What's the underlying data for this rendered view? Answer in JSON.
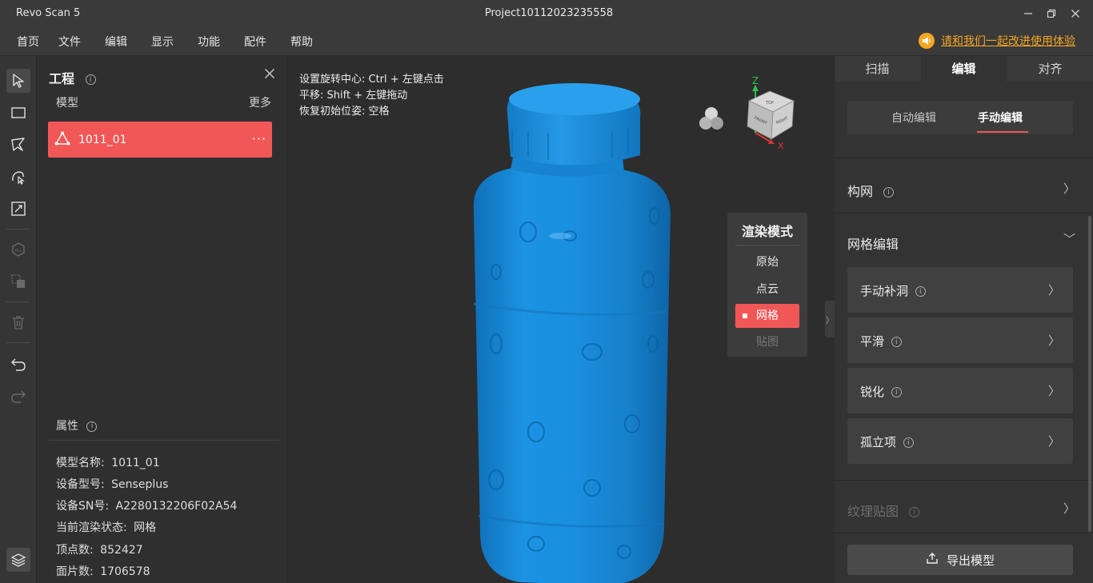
{
  "titlebar": {
    "app_name": "Revo Scan 5",
    "project_name": "Project10112023235558",
    "min_icon": "minimize-icon",
    "restore_icon": "restore-icon",
    "close_icon": "close-icon"
  },
  "menu": {
    "items": [
      "首页",
      "文件",
      "编辑",
      "显示",
      "功能",
      "配件",
      "帮助"
    ],
    "feedback_text": "请和我们一起改进使用体验"
  },
  "toolbar": {
    "tools": [
      "select-arrow-icon",
      "rect-select-icon",
      "lasso-select-icon",
      "brush-select-icon",
      "invert-select-icon",
      "select-all-icon",
      "isolate-select-icon",
      "delete-icon",
      "undo-icon",
      "redo-icon",
      "layers-icon"
    ]
  },
  "project_panel": {
    "title": "工程",
    "model_header": "模型",
    "more_label": "更多",
    "model_item": "1011_01",
    "model_item_dots": "···",
    "properties_title": "属性",
    "properties": [
      {
        "label": "模型名称:",
        "value": "1011_01"
      },
      {
        "label": "设备型号:",
        "value": "Senseplus"
      },
      {
        "label": "设备SN号:",
        "value": "A2280132206F02A54"
      },
      {
        "label": "当前渲染状态:",
        "value": "网格"
      },
      {
        "label": "顶点数:",
        "value": "852427"
      },
      {
        "label": "面片数:",
        "value": "1706578"
      }
    ]
  },
  "viewport": {
    "hints": [
      "设置旋转中心: Ctrl + 左键点击",
      "平移: Shift + 左键拖动",
      "恢复初始位姿: 空格"
    ],
    "model_color": "#1a8fe0",
    "render_mode": {
      "title": "渲染模式",
      "options": [
        "原始",
        "点云",
        "网格",
        "贴图"
      ],
      "selected": "网格",
      "disabled": "贴图"
    },
    "view_cube": {
      "axis_z": "Z",
      "axis_x": "X",
      "face_front": "FRONT",
      "face_right": "RIGHT",
      "face_top": "TOP"
    }
  },
  "right_panel": {
    "tabs": [
      "扫描",
      "编辑",
      "对齐"
    ],
    "active_tab": "编辑",
    "subtabs": [
      "自动编辑",
      "手动编辑"
    ],
    "active_subtab": "手动编辑",
    "section_mesh": "构网",
    "section_mesh_edit": "网格编辑",
    "tools": [
      "手动补洞",
      "平滑",
      "锐化",
      "孤立项"
    ],
    "section_texture": "纹理贴图",
    "export_label": "导出模型"
  },
  "colors": {
    "accent": "#f25757",
    "link": "#f5a623",
    "model": "#1a8fe0"
  }
}
